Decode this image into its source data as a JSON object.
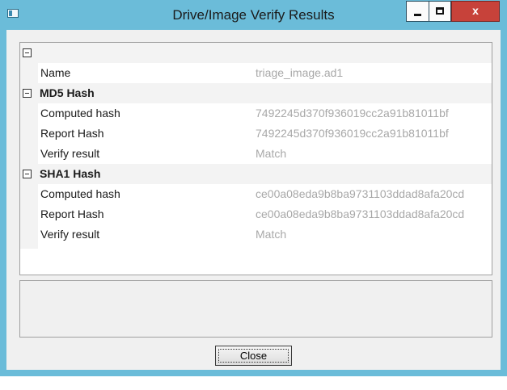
{
  "window": {
    "title": "Drive/Image Verify Results",
    "close_glyph": "x"
  },
  "grid": {
    "rows": [
      {
        "type": "category",
        "label": ""
      },
      {
        "type": "property",
        "name": "Name",
        "value": "triage_image.ad1"
      },
      {
        "type": "category",
        "label": "MD5 Hash"
      },
      {
        "type": "property",
        "name": "Computed hash",
        "value": "7492245d370f936019cc2a91b81011bf"
      },
      {
        "type": "property",
        "name": "Report Hash",
        "value": "7492245d370f936019cc2a91b81011bf"
      },
      {
        "type": "property",
        "name": "Verify result",
        "value": "Match"
      },
      {
        "type": "category",
        "label": "SHA1 Hash"
      },
      {
        "type": "property",
        "name": "Computed hash",
        "value": "ce00a08eda9b8ba9731103ddad8afa20cd"
      },
      {
        "type": "property",
        "name": "Report Hash",
        "value": "ce00a08eda9b8ba9731103ddad8afa20cd"
      },
      {
        "type": "property",
        "name": "Verify result",
        "value": "Match"
      }
    ]
  },
  "buttons": {
    "close_label": "Close"
  },
  "colors": {
    "title_bar": "#6bbcd9",
    "close_button": "#c7423a",
    "value_text": "#a8a8a8"
  }
}
